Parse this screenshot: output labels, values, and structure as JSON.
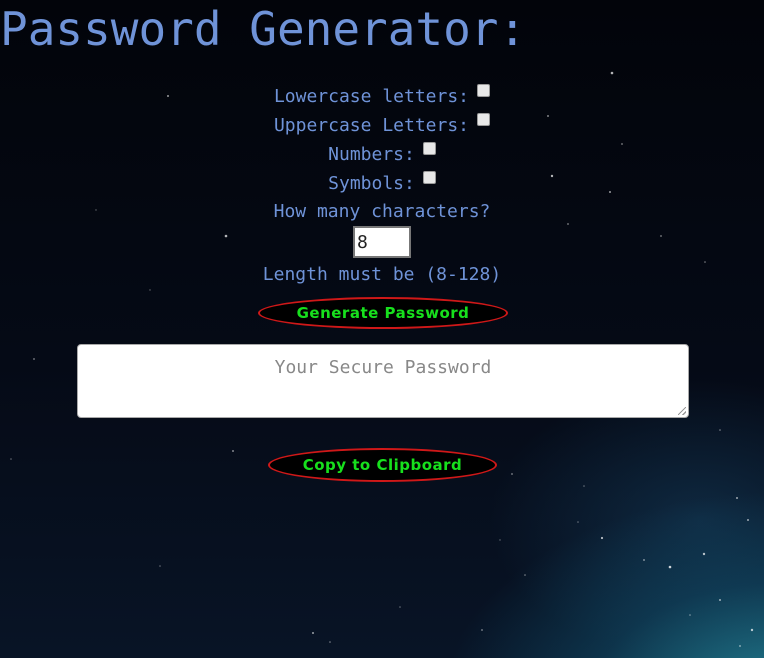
{
  "page": {
    "title": "Password Generator:"
  },
  "options": {
    "lowercase_label": "Lowercase letters:",
    "uppercase_label": "Uppercase Letters:",
    "numbers_label": "Numbers:",
    "symbols_label": "Symbols:",
    "lowercase_checked": false,
    "uppercase_checked": false,
    "numbers_checked": false,
    "symbols_checked": false
  },
  "length": {
    "question": "How many characters?",
    "value": "8",
    "note": "Length must be (8-128)"
  },
  "actions": {
    "generate_label": "Generate Password",
    "copy_label": "Copy to Clipboard"
  },
  "output": {
    "placeholder": "Your Secure Password"
  },
  "colors": {
    "text": "#6f93d8",
    "button_text": "#17e01d",
    "button_border": "#d01818",
    "background": "#02040a"
  }
}
